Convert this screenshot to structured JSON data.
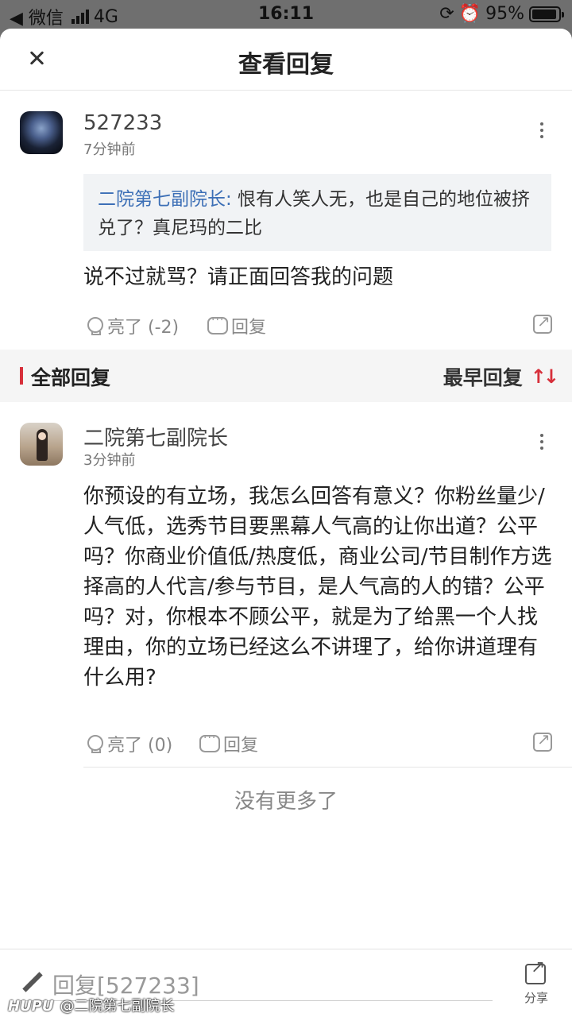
{
  "status_bar": {
    "back_app": "◀ 微信",
    "network": "4G",
    "time": "16:11",
    "battery": "95%",
    "battery_level": 0.95
  },
  "header": {
    "title": "查看回复"
  },
  "main_comment": {
    "username": "527233",
    "time": "7分钟前",
    "quote_name": "二院第七副院长:",
    "quote_text": " 恨有人笑人无，也是自己的地位被挤兑了？真尼玛的二比",
    "text": "说不过就骂？请正面回答我的问题",
    "like_label": "亮了 (-2)",
    "reply_label": "回复"
  },
  "sort_bar": {
    "label": "全部回复",
    "sort_label": "最早回复"
  },
  "replies": [
    {
      "username": "二院第七副院长",
      "time": "3分钟前",
      "text": "你预设的有立场，我怎么回答有意义？你粉丝量少/人气低，选秀节目要黑幕人气高的让你出道？公平吗？你商业价值低/热度低，商业公司/节目制作方选择高的人代言/参与节目，是人气高的人的错？公平吗？对，你根本不顾公平，就是为了给黑一个人找理由，你的立场已经这么不讲理了，给你讲道理有什么用?",
      "like_label": "亮了 (0)",
      "reply_label": "回复"
    }
  ],
  "footer": {
    "no_more": "没有更多了"
  },
  "bottom_bar": {
    "reply_placeholder": "回复[527233]",
    "share_label": "分享"
  },
  "watermark": {
    "logo": "HUPU",
    "text": "@二院第七副院长"
  },
  "colors": {
    "accent": "#d7303b",
    "link": "#3c6fb6"
  }
}
